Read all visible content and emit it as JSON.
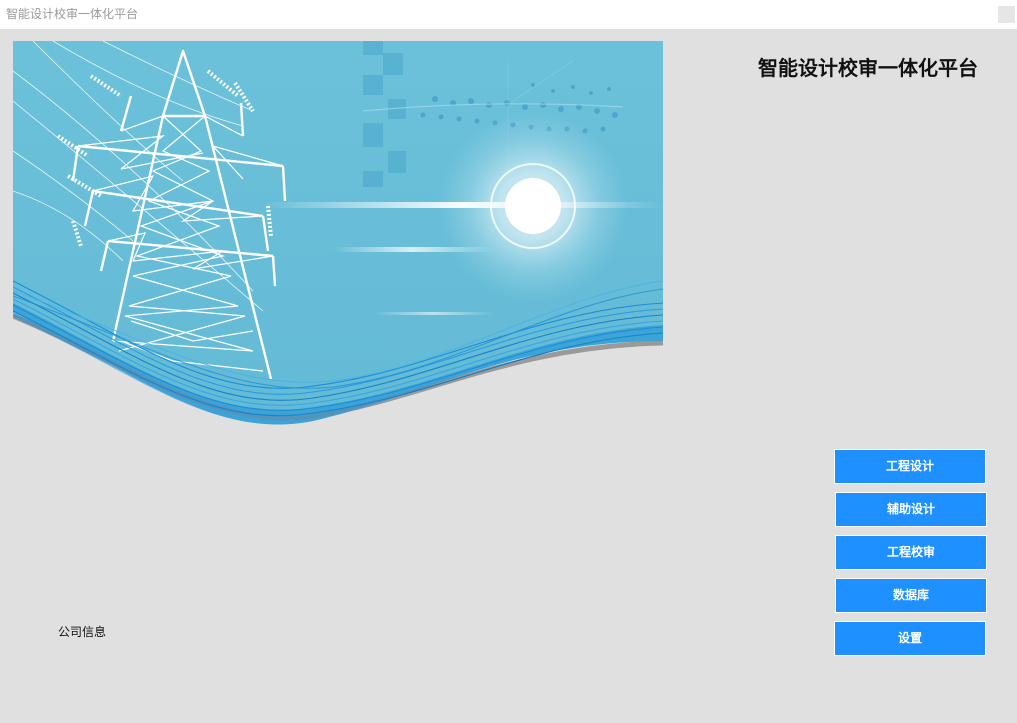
{
  "window": {
    "title": "智能设计校审一体化平台"
  },
  "header": {
    "app_title": "智能设计校审一体化平台"
  },
  "banner": {
    "image": "power-transmission-tower-illustration",
    "colors": {
      "sky": "#6bbfd8",
      "wave": "#1a8fd8",
      "tower": "#ffffff"
    }
  },
  "footer": {
    "company_info": "公司信息"
  },
  "menu": {
    "items": [
      {
        "label": "工程设计"
      },
      {
        "label": "辅助设计"
      },
      {
        "label": "工程校审"
      },
      {
        "label": "数据库"
      },
      {
        "label": "设置"
      }
    ]
  },
  "colors": {
    "button": "#1e90ff",
    "background": "#e0e0e0"
  }
}
